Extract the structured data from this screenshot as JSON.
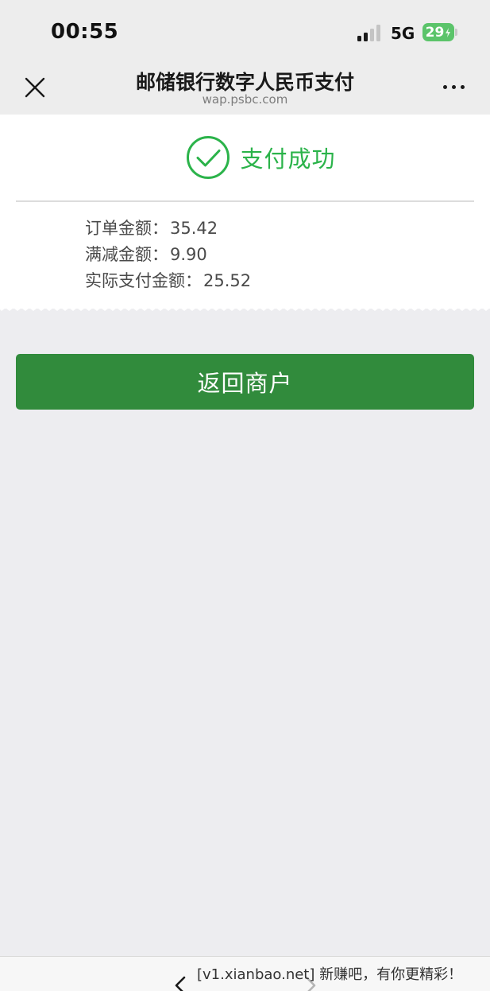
{
  "status_bar": {
    "time": "00:55",
    "network": "5G",
    "battery_level": "29",
    "battery_color": "#5bc46a"
  },
  "nav": {
    "title": "邮储银行数字人民币支付",
    "subtitle": "wap.psbc.com"
  },
  "result": {
    "status_text": "支付成功",
    "status_color": "#2bb34a",
    "details": [
      {
        "label": "订单金额：",
        "value": "35.42"
      },
      {
        "label": "满减金额：",
        "value": "9.90"
      },
      {
        "label": "实际支付金额：",
        "value": "25.52"
      }
    ]
  },
  "actions": {
    "return_label": "返回商户",
    "button_color": "#318b3c"
  },
  "watermark": {
    "text": "[v1.xianbao.net] 新赚吧，有你更精彩！"
  }
}
